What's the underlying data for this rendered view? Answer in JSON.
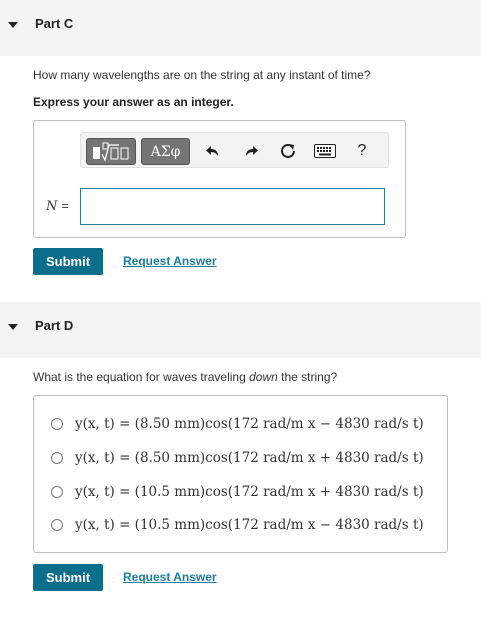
{
  "part_c": {
    "title": "Part C",
    "question": "How many wavelengths are on the string at any instant of time?",
    "instruction": "Express your answer as an integer.",
    "toolbar": {
      "templates_icon": "fraction-sqrt-template-icon",
      "symbols_label": "ΑΣφ",
      "undo_icon": "undo-icon",
      "redo_icon": "redo-icon",
      "reset_icon": "reset-icon",
      "keyboard_icon": "keyboard-icon",
      "help_label": "?"
    },
    "variable_label": "N",
    "equals": "=",
    "input_value": "",
    "submit_label": "Submit",
    "request_label": "Request Answer"
  },
  "part_d": {
    "title": "Part D",
    "question_before": "What is the equation for waves traveling ",
    "question_emph": "down",
    "question_after": " the string?",
    "choices": [
      {
        "label": "y(x, t) = (8.50 mm)cos(172 rad/m x − 4830 rad/s t)",
        "selected": false
      },
      {
        "label": "y(x, t) = (8.50 mm)cos(172 rad/m x + 4830 rad/s t)",
        "selected": false
      },
      {
        "label": "y(x, t) = (10.5 mm)cos(172 rad/m x + 4830 rad/s t)",
        "selected": false
      },
      {
        "label": "y(x, t) = (10.5 mm)cos(172 rad/m x − 4830 rad/s t)",
        "selected": false
      }
    ],
    "submit_label": "Submit",
    "request_label": "Request Answer"
  },
  "colors": {
    "submit_bg": "#0b6f8c",
    "link": "#1a7fa3",
    "input_border": "#2a7f95",
    "header_bg": "#f4f4f4"
  }
}
